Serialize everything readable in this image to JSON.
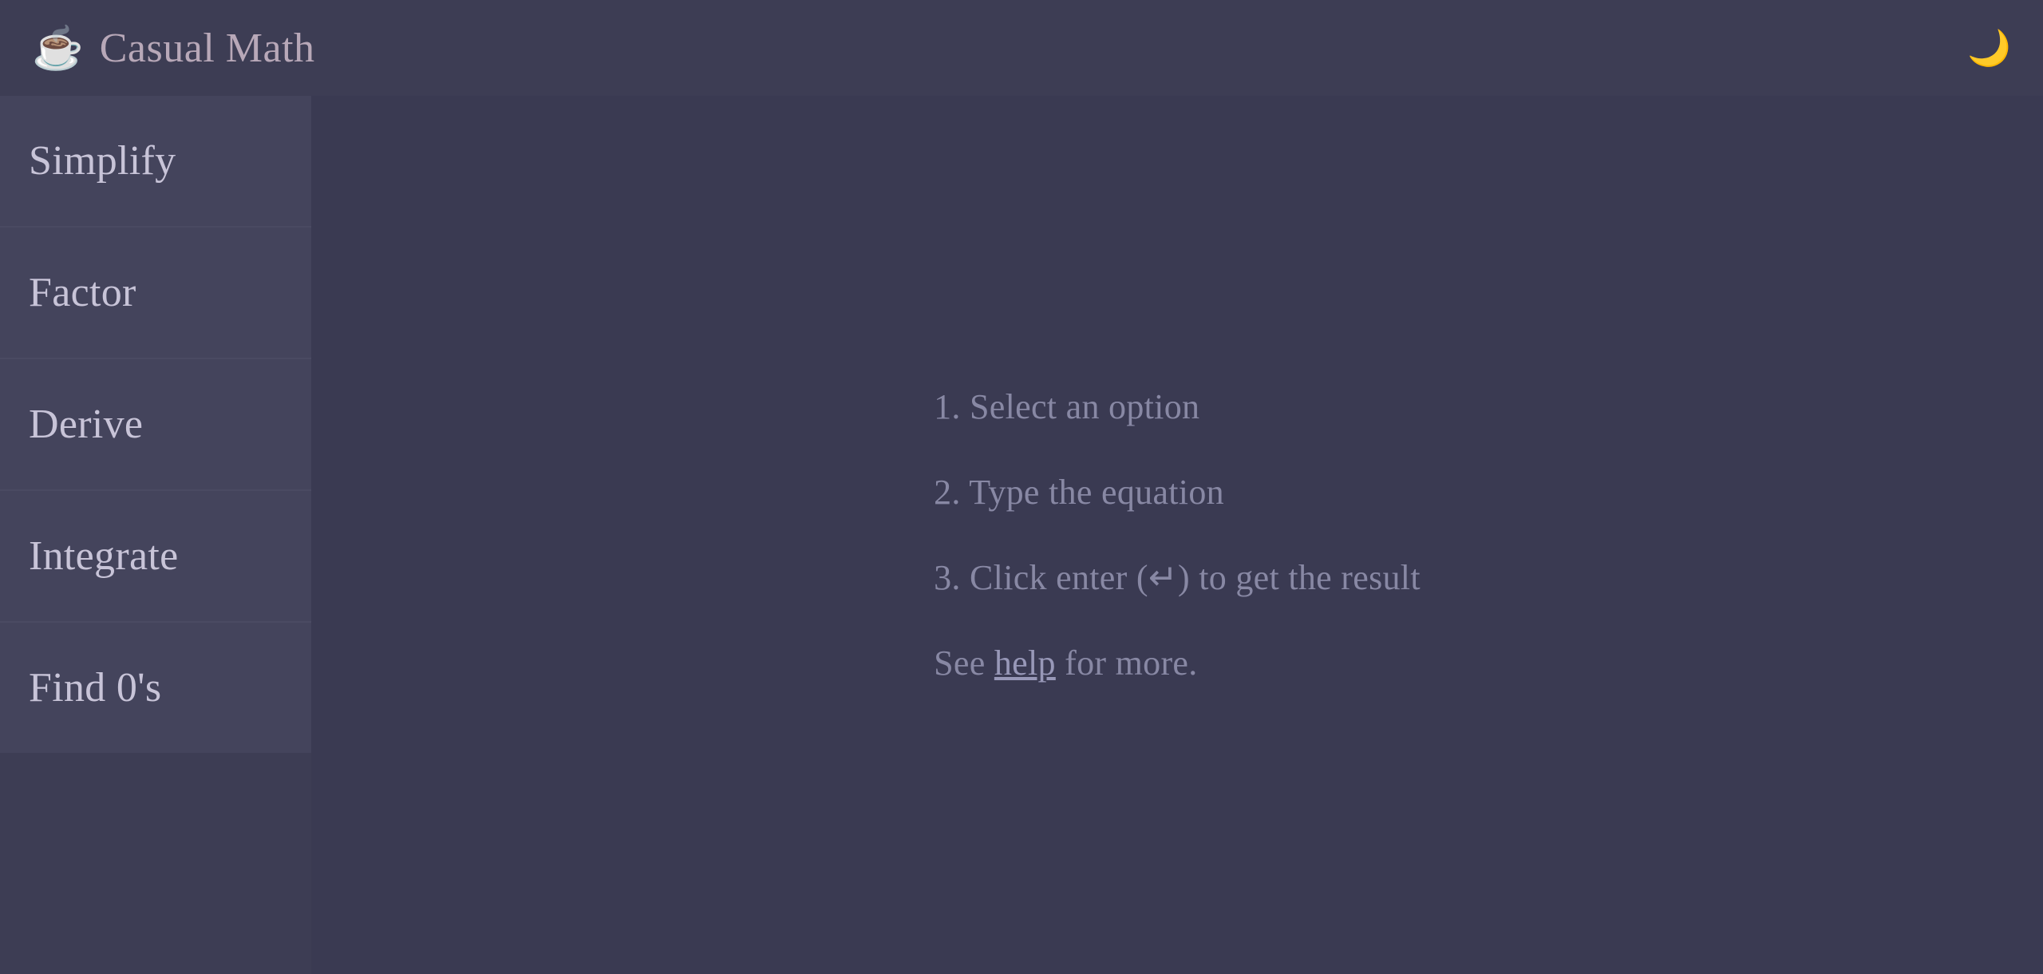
{
  "header": {
    "app_title": "Casual Math",
    "app_icon": "☕",
    "theme_toggle_icon": "🌙"
  },
  "sidebar": {
    "items": [
      {
        "label": "Simplify",
        "id": "simplify"
      },
      {
        "label": "Factor",
        "id": "factor"
      },
      {
        "label": "Derive",
        "id": "derive"
      },
      {
        "label": "Integrate",
        "id": "integrate"
      },
      {
        "label": "Find 0's",
        "id": "find-zeros"
      }
    ]
  },
  "content": {
    "instructions": [
      {
        "text": "1. Select an option"
      },
      {
        "text": "2. Type the equation"
      },
      {
        "text": "3. Click enter (↵) to get the result"
      }
    ],
    "help_prefix": "See ",
    "help_link_text": "help",
    "help_suffix": " for more."
  }
}
